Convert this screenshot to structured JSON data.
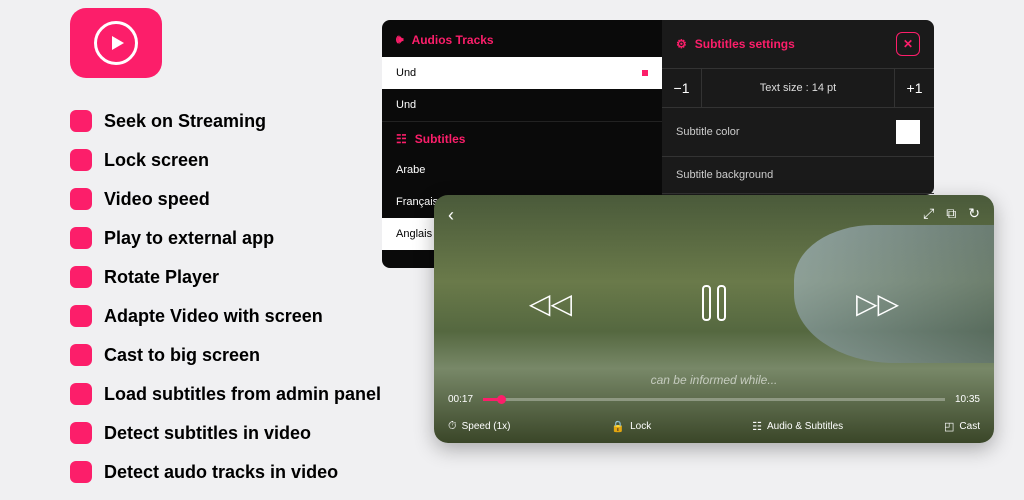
{
  "features": [
    "Seek on Streaming",
    "Lock screen",
    "Video speed",
    "Play to external app",
    "Rotate Player",
    "Adapte Video with screen",
    "Cast to big screen",
    "Load subtitles from admin panel",
    "Detect subtitles in video",
    "Detect audo tracks in video"
  ],
  "audio_panel": {
    "title": "Audios Tracks",
    "tracks": [
      "Und",
      "Und"
    ],
    "sub_title": "Subtitles",
    "subtitles": [
      "Arabe",
      "Français",
      "Anglais"
    ]
  },
  "subtitle_settings": {
    "title": "Subtitles settings",
    "minus": "−1",
    "size_label": "Text size : 14 pt",
    "plus": "+1",
    "color_label": "Subtitle color",
    "bg_label": "Subtitle background"
  },
  "player": {
    "current_time": "00:17",
    "total_time": "10:35",
    "progress_pct": 3,
    "speed_label": "Speed (1x)",
    "lock_label": "Lock",
    "audio_label": "Audio & Subtitles",
    "cast_label": "Cast",
    "subtitle_text": "can be informed while..."
  }
}
